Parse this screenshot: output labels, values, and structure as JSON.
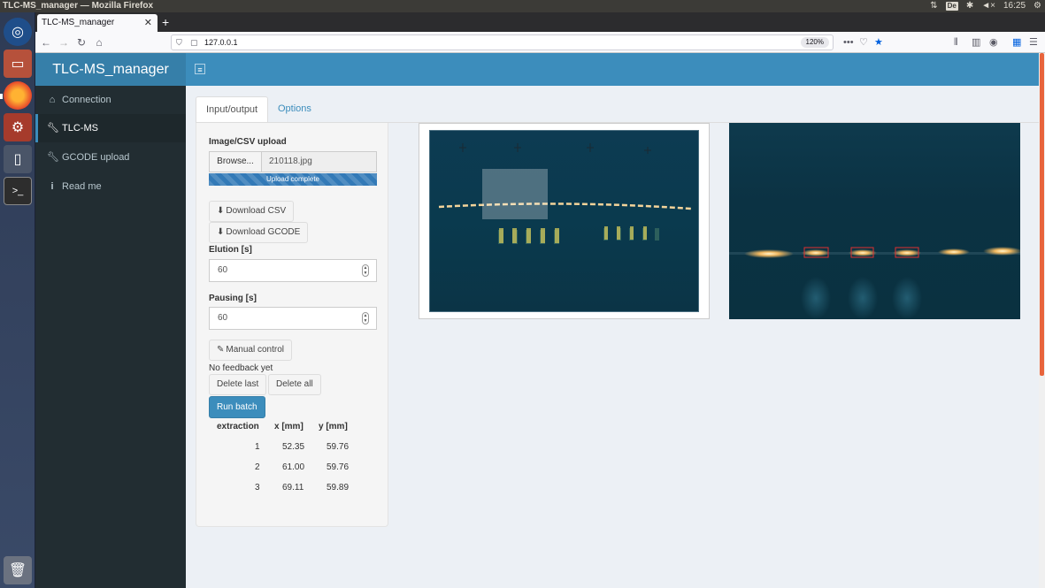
{
  "os": {
    "window_title": "TLC-MS_manager — Mozilla Firefox",
    "keyboard": "De",
    "volume": "◄×",
    "time": "16:25"
  },
  "browser": {
    "tab_title": "TLC-MS_manager",
    "url": "127.0.0.1",
    "zoom": "120%"
  },
  "app": {
    "title": "TLC-MS_manager",
    "sidebar": [
      {
        "label": "Connection",
        "icon": "home-icon",
        "active": false
      },
      {
        "label": "TLC-MS",
        "icon": "wrench-icon",
        "active": true
      },
      {
        "label": "GCODE upload",
        "icon": "wrench-icon",
        "active": false
      },
      {
        "label": "Read me",
        "icon": "info-icon",
        "active": false
      }
    ],
    "tabs": [
      "Input/output",
      "Options"
    ],
    "upload": {
      "label": "Image/CSV upload",
      "browse": "Browse...",
      "filename": "210118.jpg",
      "progress_text": "Upload complete",
      "progress": 1.0
    },
    "buttons": {
      "download_csv": "Download CSV",
      "download_gcode": "Download GCODE",
      "manual_control": "Manual control",
      "delete_last": "Delete last",
      "delete_all": "Delete all",
      "run_batch": "Run batch"
    },
    "elution": {
      "label": "Elution [s]",
      "value": "60"
    },
    "pausing": {
      "label": "Pausing [s]",
      "value": "60"
    },
    "feedback": "No feedback yet",
    "table": {
      "headers": [
        "extraction",
        "x [mm]",
        "y [mm]"
      ],
      "rows": [
        [
          "1",
          "52.35",
          "59.76"
        ],
        [
          "2",
          "61.00",
          "59.76"
        ],
        [
          "3",
          "69.11",
          "59.89"
        ]
      ]
    }
  }
}
